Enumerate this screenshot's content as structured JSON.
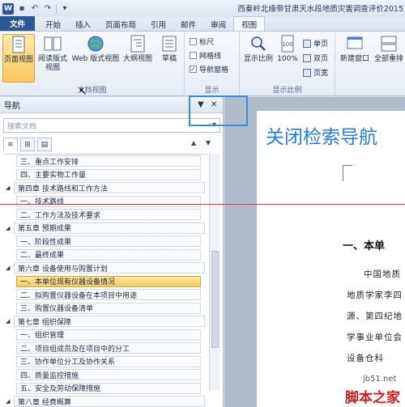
{
  "window": {
    "title": "西秦岭北缘带甘肃天水段地质灾害调查评价2015"
  },
  "quick_access": {
    "app_letter": "W"
  },
  "tabs": [
    "文件",
    "开始",
    "插入",
    "页面布局",
    "引用",
    "邮件",
    "审阅",
    "视图"
  ],
  "ribbon": {
    "doc_views": {
      "label": "文档视图",
      "buttons": [
        "页面视图",
        "阅读版式视图",
        "Web 版式视图",
        "大纲视图",
        "草稿"
      ]
    },
    "show": {
      "label": "显示",
      "items": [
        {
          "label": "标尺",
          "checked": false
        },
        {
          "label": "网格线",
          "checked": false
        },
        {
          "label": "导航窗格",
          "checked": true
        }
      ]
    },
    "zoom": {
      "label": "显示比例",
      "buttons": [
        "显示比例",
        "100%"
      ],
      "small": [
        "单页",
        "双页",
        "页宽"
      ]
    },
    "window": {
      "buttons": [
        "新建窗口",
        "全部重排"
      ]
    }
  },
  "nav": {
    "title": "导航",
    "search_placeholder": "搜索文档",
    "items": [
      {
        "level": 1,
        "text": "三、重点工作安排"
      },
      {
        "level": 1,
        "text": "四、主要实物工作量"
      },
      {
        "level": 0,
        "text": "第四章 技术路线和工作方法"
      },
      {
        "level": 1,
        "text": "一、技术路线"
      },
      {
        "level": 1,
        "text": "二、工作方法及技术要求"
      },
      {
        "level": 0,
        "text": "第五章 预期成果"
      },
      {
        "level": 1,
        "text": "一、阶段性成果"
      },
      {
        "level": 1,
        "text": "二、最终成果"
      },
      {
        "level": 0,
        "text": "第六章 设备使用与购置计划"
      },
      {
        "level": 1,
        "text": "一、本单位现有仪器设备情况",
        "selected": true
      },
      {
        "level": 1,
        "text": "二、拟购置仪器设备在本项目中用途"
      },
      {
        "level": 1,
        "text": "三、购置仪器设备清单"
      },
      {
        "level": 0,
        "text": "第七章 组织保障"
      },
      {
        "level": 1,
        "text": "一、组织管理"
      },
      {
        "level": 1,
        "text": "二、项目组成员及在项目中的分工"
      },
      {
        "level": 1,
        "text": "三、协作单位分工及协作关系"
      },
      {
        "level": 1,
        "text": "四、质量监控措施"
      },
      {
        "level": 1,
        "text": "五、安全及劳动保障措施"
      },
      {
        "level": 0,
        "text": "第八章 经费概算"
      }
    ]
  },
  "document": {
    "heading": "关闭检索导航",
    "section_title": "一、本单",
    "lines": [
      "中国地质",
      "地质学家李四",
      "源、第四纪地",
      "学事业单位会",
      "设备仓科"
    ]
  },
  "watermark": {
    "site": "jb51.net",
    "name": "脚本之家"
  },
  "colors": {
    "file_tab": "#2b5797",
    "doc_heading": "#2a7bd2",
    "selection": "#f8cc5e",
    "highlight_box": "#3a8ce0",
    "guide_line": "#e23a3a"
  }
}
